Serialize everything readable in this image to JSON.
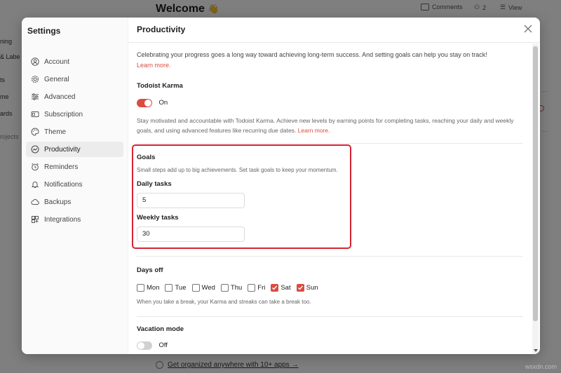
{
  "background": {
    "title": "Welcome",
    "topbar": {
      "comments_label": "Comments",
      "people_count": "2",
      "view_label": "View"
    },
    "left_fragments": [
      "ning",
      "& Labe",
      "ts",
      "me",
      "ards",
      "rojects"
    ],
    "bottom_link": "Get organized anywhere with 10+ apps →",
    "watermark": "wsxdn.com"
  },
  "settings": {
    "sidebar_title": "Settings",
    "items": [
      {
        "label": "Account",
        "icon": "account-icon",
        "active": false
      },
      {
        "label": "General",
        "icon": "gear-icon",
        "active": false
      },
      {
        "label": "Advanced",
        "icon": "sliders-icon",
        "active": false
      },
      {
        "label": "Subscription",
        "icon": "subscription-icon",
        "active": false
      },
      {
        "label": "Theme",
        "icon": "palette-icon",
        "active": false
      },
      {
        "label": "Productivity",
        "icon": "productivity-icon",
        "active": true
      },
      {
        "label": "Reminders",
        "icon": "reminder-icon",
        "active": false
      },
      {
        "label": "Notifications",
        "icon": "bell-icon",
        "active": false
      },
      {
        "label": "Backups",
        "icon": "cloud-icon",
        "active": false
      },
      {
        "label": "Integrations",
        "icon": "puzzle-icon",
        "active": false
      }
    ],
    "page_title": "Productivity",
    "intro_text": "Celebrating your progress goes a long way toward achieving long-term success. And setting goals can help you stay on track!",
    "intro_link": "Learn more.",
    "karma": {
      "title": "Todoist Karma",
      "toggle_label": "On",
      "enabled": true,
      "description": "Stay motivated and accountable with Todoist Karma. Achieve new levels by earning points for completing tasks, reaching your daily and weekly goals, and using advanced features like recurring due dates.",
      "link": "Learn more."
    },
    "goals": {
      "title": "Goals",
      "description": "Small steps add up to big achievements. Set task goals to keep your momentum.",
      "daily_label": "Daily tasks",
      "daily_value": "5",
      "weekly_label": "Weekly tasks",
      "weekly_value": "30"
    },
    "days_off": {
      "title": "Days off",
      "days": [
        {
          "label": "Mon",
          "checked": false
        },
        {
          "label": "Tue",
          "checked": false
        },
        {
          "label": "Wed",
          "checked": false
        },
        {
          "label": "Thu",
          "checked": false
        },
        {
          "label": "Fri",
          "checked": false
        },
        {
          "label": "Sat",
          "checked": true
        },
        {
          "label": "Sun",
          "checked": true
        }
      ],
      "description": "When you take a break, your Karma and streaks can take a break too."
    },
    "vacation": {
      "title": "Vacation mode",
      "toggle_label": "Off",
      "enabled": false
    }
  },
  "colors": {
    "accent": "#db4c3f",
    "highlight_box": "#d62433"
  }
}
